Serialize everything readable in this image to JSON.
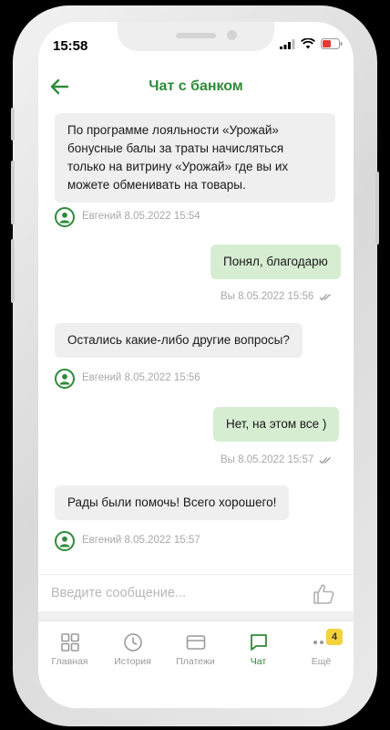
{
  "status_bar": {
    "time": "15:58"
  },
  "header": {
    "title": "Чат с банком"
  },
  "messages": [
    {
      "direction": "in",
      "text": "По программе лояльности «Урожай» бонусные балы за траты начисляться только на витрину «Урожай» где вы их можете обменивать на товары.",
      "meta": "Евгений 8.05.2022 15:54"
    },
    {
      "direction": "out",
      "text": "Понял, благодарю",
      "meta": "Вы 8.05.2022 15:56"
    },
    {
      "direction": "in",
      "text": "Остались какие-либо другие вопросы?",
      "meta": "Евгений 8.05.2022 15:56"
    },
    {
      "direction": "out",
      "text": "Нет, на этом все )",
      "meta": "Вы 8.05.2022 15:57"
    },
    {
      "direction": "in",
      "text": "Рады были помочь! Всего хорошего!",
      "meta": "Евгений 8.05.2022 15:57"
    }
  ],
  "input": {
    "placeholder": "Введите сообщение..."
  },
  "tabs": [
    {
      "label": "Главная",
      "icon": "grid-icon",
      "active": false
    },
    {
      "label": "История",
      "icon": "clock-icon",
      "active": false
    },
    {
      "label": "Платежи",
      "icon": "card-icon",
      "active": false
    },
    {
      "label": "Чат",
      "icon": "chat-icon",
      "active": true
    },
    {
      "label": "Ещё",
      "icon": "more-icon",
      "active": false,
      "badge": "4"
    }
  ],
  "colors": {
    "accent": "#2e8b3a",
    "outgoing_bubble": "#d6edd2",
    "incoming_bubble": "#efefef",
    "badge": "#f5d23b"
  }
}
